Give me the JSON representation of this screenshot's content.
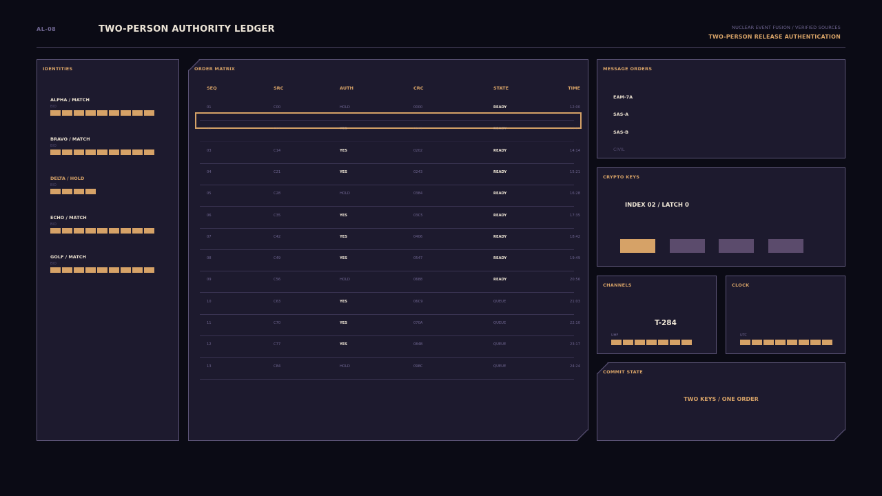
{
  "header": {
    "code": "AL-08",
    "title": "TWO-PERSON AUTHORITY LEDGER",
    "subtitle": "NUCLEAR EVENT FUSION / VERIFIED SOURCES",
    "mode": "TWO-PERSON RELEASE AUTHENTICATION"
  },
  "identities": {
    "title": "IDENTITIES",
    "items": [
      {
        "name": "ALPHA / MATCH",
        "sub": "BIO",
        "level": 9,
        "status": "match"
      },
      {
        "name": "BRAVO / MATCH",
        "sub": "BIO",
        "level": 9,
        "status": "match"
      },
      {
        "name": "DELTA / HOLD",
        "sub": "BIO",
        "level": 4,
        "status": "hold"
      },
      {
        "name": "ECHO / MATCH",
        "sub": "BIO",
        "level": 9,
        "status": "match"
      },
      {
        "name": "GOLF / MATCH",
        "sub": "BIO",
        "level": 9,
        "status": "match"
      }
    ]
  },
  "orders": {
    "title": "ORDER MATRIX",
    "columns": [
      "SEQ",
      "SRC",
      "AUTH",
      "CRC",
      "STATE",
      "TIME"
    ],
    "selected_index": 1,
    "rows": [
      {
        "seq": "01",
        "src": "C00",
        "auth": "HOLD",
        "crc": "0000",
        "state": "READY",
        "time": "12:00"
      },
      {
        "seq": "02",
        "src": "C07",
        "auth": "YES",
        "crc": "0161",
        "state": "READY",
        "time": "13:07"
      },
      {
        "seq": "03",
        "src": "C14",
        "auth": "YES",
        "crc": "0202",
        "state": "READY",
        "time": "14:14"
      },
      {
        "seq": "04",
        "src": "C21",
        "auth": "YES",
        "crc": "0243",
        "state": "READY",
        "time": "15:21"
      },
      {
        "seq": "05",
        "src": "C28",
        "auth": "HOLD",
        "crc": "0384",
        "state": "READY",
        "time": "16:28"
      },
      {
        "seq": "06",
        "src": "C35",
        "auth": "YES",
        "crc": "03C5",
        "state": "READY",
        "time": "17:35"
      },
      {
        "seq": "07",
        "src": "C42",
        "auth": "YES",
        "crc": "0406",
        "state": "READY",
        "time": "18:42"
      },
      {
        "seq": "08",
        "src": "C49",
        "auth": "YES",
        "crc": "0547",
        "state": "READY",
        "time": "19:49"
      },
      {
        "seq": "09",
        "src": "C56",
        "auth": "HOLD",
        "crc": "0688",
        "state": "READY",
        "time": "20:56"
      },
      {
        "seq": "10",
        "src": "C63",
        "auth": "YES",
        "crc": "06C9",
        "state": "QUEUE",
        "time": "21:03"
      },
      {
        "seq": "11",
        "src": "C70",
        "auth": "YES",
        "crc": "070A",
        "state": "QUEUE",
        "time": "22:10"
      },
      {
        "seq": "12",
        "src": "C77",
        "auth": "YES",
        "crc": "084B",
        "state": "QUEUE",
        "time": "23:17"
      },
      {
        "seq": "13",
        "src": "C84",
        "auth": "HOLD",
        "crc": "098C",
        "state": "QUEUE",
        "time": "24:24"
      }
    ]
  },
  "messages": {
    "title": "MESSAGE ORDERS",
    "items": [
      {
        "label": "EAM-7A",
        "active": true
      },
      {
        "label": "SAS-A",
        "active": true
      },
      {
        "label": "SAS-B",
        "active": true
      },
      {
        "label": "CIVIL",
        "active": false
      }
    ]
  },
  "crypto": {
    "title": "CRYPTO KEYS",
    "label": "INDEX 02 / LATCH 0",
    "keys": [
      true,
      false,
      false,
      false
    ]
  },
  "channels": {
    "title": "CHANNELS",
    "value": "T-284",
    "sub": "UHF",
    "level": 7
  },
  "clock": {
    "title": "CLOCK",
    "sub": "UTC",
    "level": 8
  },
  "commit": {
    "title": "COMMIT STATE",
    "text": "TWO KEYS / ONE ORDER"
  },
  "colors": {
    "accent": "#d6a267",
    "panel": "#1d1a2e",
    "border": "#5d5578",
    "background": "#0b0b15"
  }
}
